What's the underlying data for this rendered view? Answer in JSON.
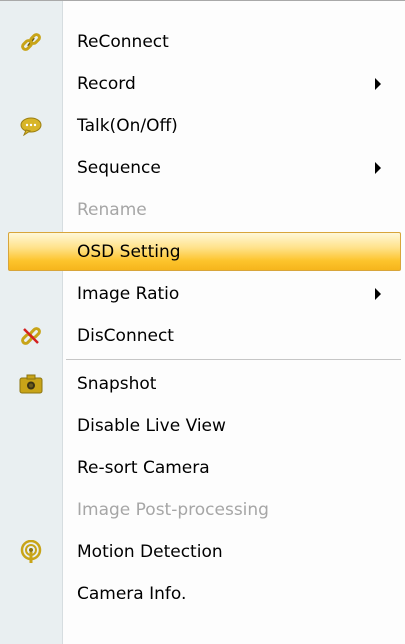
{
  "menu": {
    "items": [
      {
        "label": "ReConnect",
        "icon": "link-icon"
      },
      {
        "label": "Record",
        "submenu": true
      },
      {
        "label": "Talk(On/Off)",
        "icon": "speech-bubble-icon"
      },
      {
        "label": "Sequence",
        "submenu": true
      },
      {
        "label": "Rename",
        "disabled": true
      },
      {
        "label": "OSD Setting",
        "highlighted": true
      },
      {
        "label": "Image Ratio",
        "submenu": true
      },
      {
        "label": "DisConnect",
        "icon": "broken-link-icon"
      },
      {
        "label": "Snapshot",
        "icon": "camera-icon"
      },
      {
        "label": "Disable Live View"
      },
      {
        "label": "Re-sort Camera"
      },
      {
        "label": "Image Post-processing",
        "disabled": true
      },
      {
        "label": "Motion Detection",
        "icon": "motion-sensor-icon"
      },
      {
        "label": "Camera Info."
      }
    ]
  },
  "colors": {
    "gutter": "#e9eff1",
    "highlight": "#fdc42c",
    "disabled_text": "#a6a6a6",
    "icon_gold": "#c8a418"
  }
}
